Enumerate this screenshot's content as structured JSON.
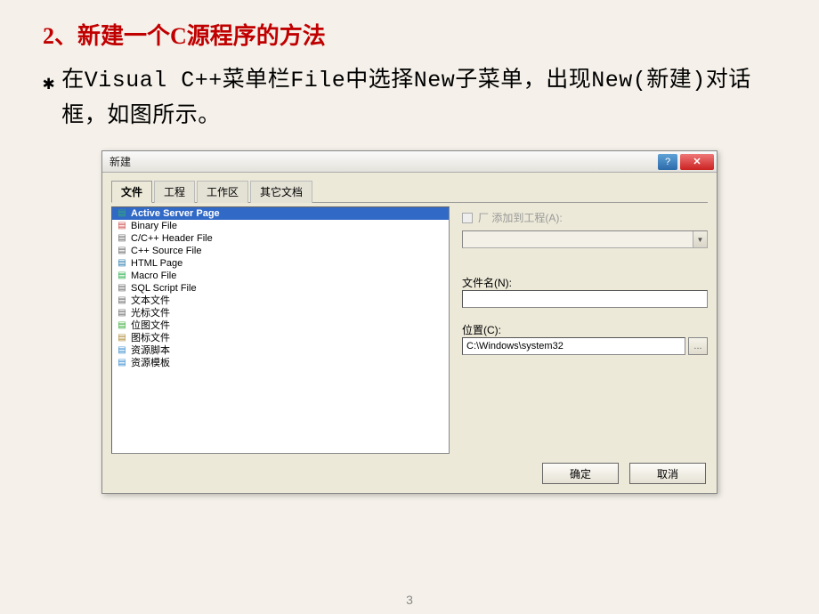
{
  "heading": "2、新建一个C源程序的方法",
  "bullet_marker": "✱",
  "body_text": "在Visual C++菜单栏File中选择New子菜单，出现New(新建)对话框，如图所示。",
  "page_number": "3",
  "dialog": {
    "title": "新建",
    "help_btn": "?",
    "close_btn": "✕",
    "tabs": [
      "文件",
      "工程",
      "工作区",
      "其它文档"
    ],
    "active_tab": 0,
    "file_types": [
      {
        "icon": "📄",
        "label": "Active Server Page",
        "selected": true,
        "icon_color": "#3a7"
      },
      {
        "icon": "📄",
        "label": "Binary File",
        "icon_color": "#c44"
      },
      {
        "icon": "📄",
        "label": "C/C++ Header File",
        "icon_color": "#666"
      },
      {
        "icon": "📄",
        "label": "C++ Source File",
        "icon_color": "#666"
      },
      {
        "icon": "📄",
        "label": "HTML Page",
        "icon_color": "#27a"
      },
      {
        "icon": "📄",
        "label": "Macro File",
        "icon_color": "#2a4"
      },
      {
        "icon": "📄",
        "label": "SQL Script File",
        "icon_color": "#666"
      },
      {
        "icon": "📄",
        "label": "文本文件",
        "icon_color": "#666"
      },
      {
        "icon": "📄",
        "label": "光标文件",
        "icon_color": "#666"
      },
      {
        "icon": "📄",
        "label": "位图文件",
        "icon_color": "#3a3"
      },
      {
        "icon": "📄",
        "label": "图标文件",
        "icon_color": "#a83"
      },
      {
        "icon": "📄",
        "label": "资源脚本",
        "icon_color": "#38c"
      },
      {
        "icon": "📄",
        "label": "资源模板",
        "icon_color": "#38c"
      }
    ],
    "add_to_project_label": "添加到工程(A):",
    "filename_label": "文件名(N):",
    "filename_value": "",
    "location_label": "位置(C):",
    "location_value": "C:\\Windows\\system32",
    "browse_label": "...",
    "ok_label": "确定",
    "cancel_label": "取消"
  }
}
